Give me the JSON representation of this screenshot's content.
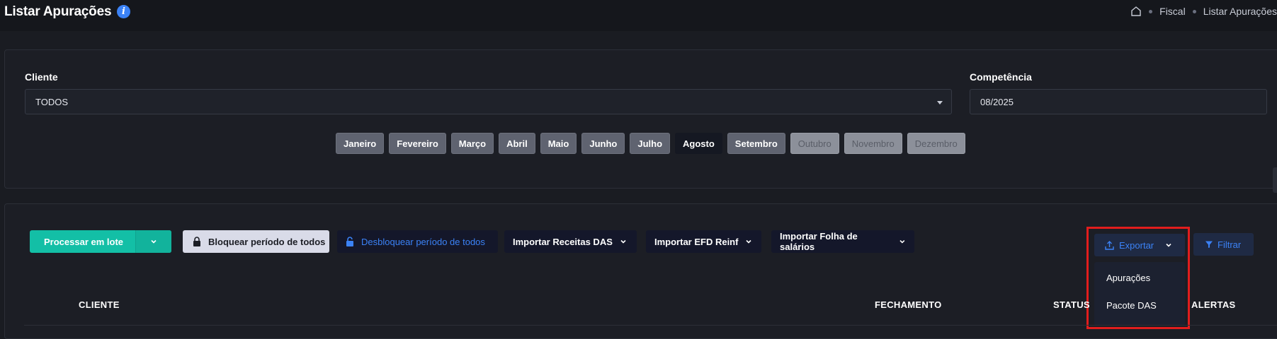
{
  "header": {
    "title": "Listar Apurações",
    "info_icon": "info-icon",
    "breadcrumb": [
      "Fiscal",
      "Listar Apurações"
    ]
  },
  "filters": {
    "cliente_label": "Cliente",
    "cliente_value": "TODOS",
    "competencia_label": "Competência",
    "competencia_value": "08/2025",
    "months": [
      {
        "label": "Janeiro",
        "state": "past"
      },
      {
        "label": "Fevereiro",
        "state": "past"
      },
      {
        "label": "Março",
        "state": "past"
      },
      {
        "label": "Abril",
        "state": "past"
      },
      {
        "label": "Maio",
        "state": "past"
      },
      {
        "label": "Junho",
        "state": "past"
      },
      {
        "label": "Julho",
        "state": "past"
      },
      {
        "label": "Agosto",
        "state": "active"
      },
      {
        "label": "Setembro",
        "state": "past"
      },
      {
        "label": "Outubro",
        "state": "future"
      },
      {
        "label": "Novembro",
        "state": "future"
      },
      {
        "label": "Dezembro",
        "state": "future"
      }
    ]
  },
  "toolbar": {
    "processar_label": "Processar em lote",
    "bloquear_label": "Bloquear período de todos",
    "desbloquear_label": "Desbloquear período de todos",
    "importar_receitas_label": "Importar Receitas DAS",
    "importar_efd_label": "Importar EFD Reinf",
    "importar_folha_label": "Importar Folha de salários",
    "exportar_label": "Exportar",
    "filtrar_label": "Filtrar",
    "export_menu": [
      "Apurações",
      "Pacote DAS"
    ]
  },
  "table": {
    "headers": [
      "CLIENTE",
      "FECHAMENTO",
      "STATUS",
      "ALERTAS"
    ]
  },
  "colors": {
    "accent_teal": "#13bfa6",
    "link_blue": "#3b82f6",
    "highlight_red": "#e11d1d"
  }
}
